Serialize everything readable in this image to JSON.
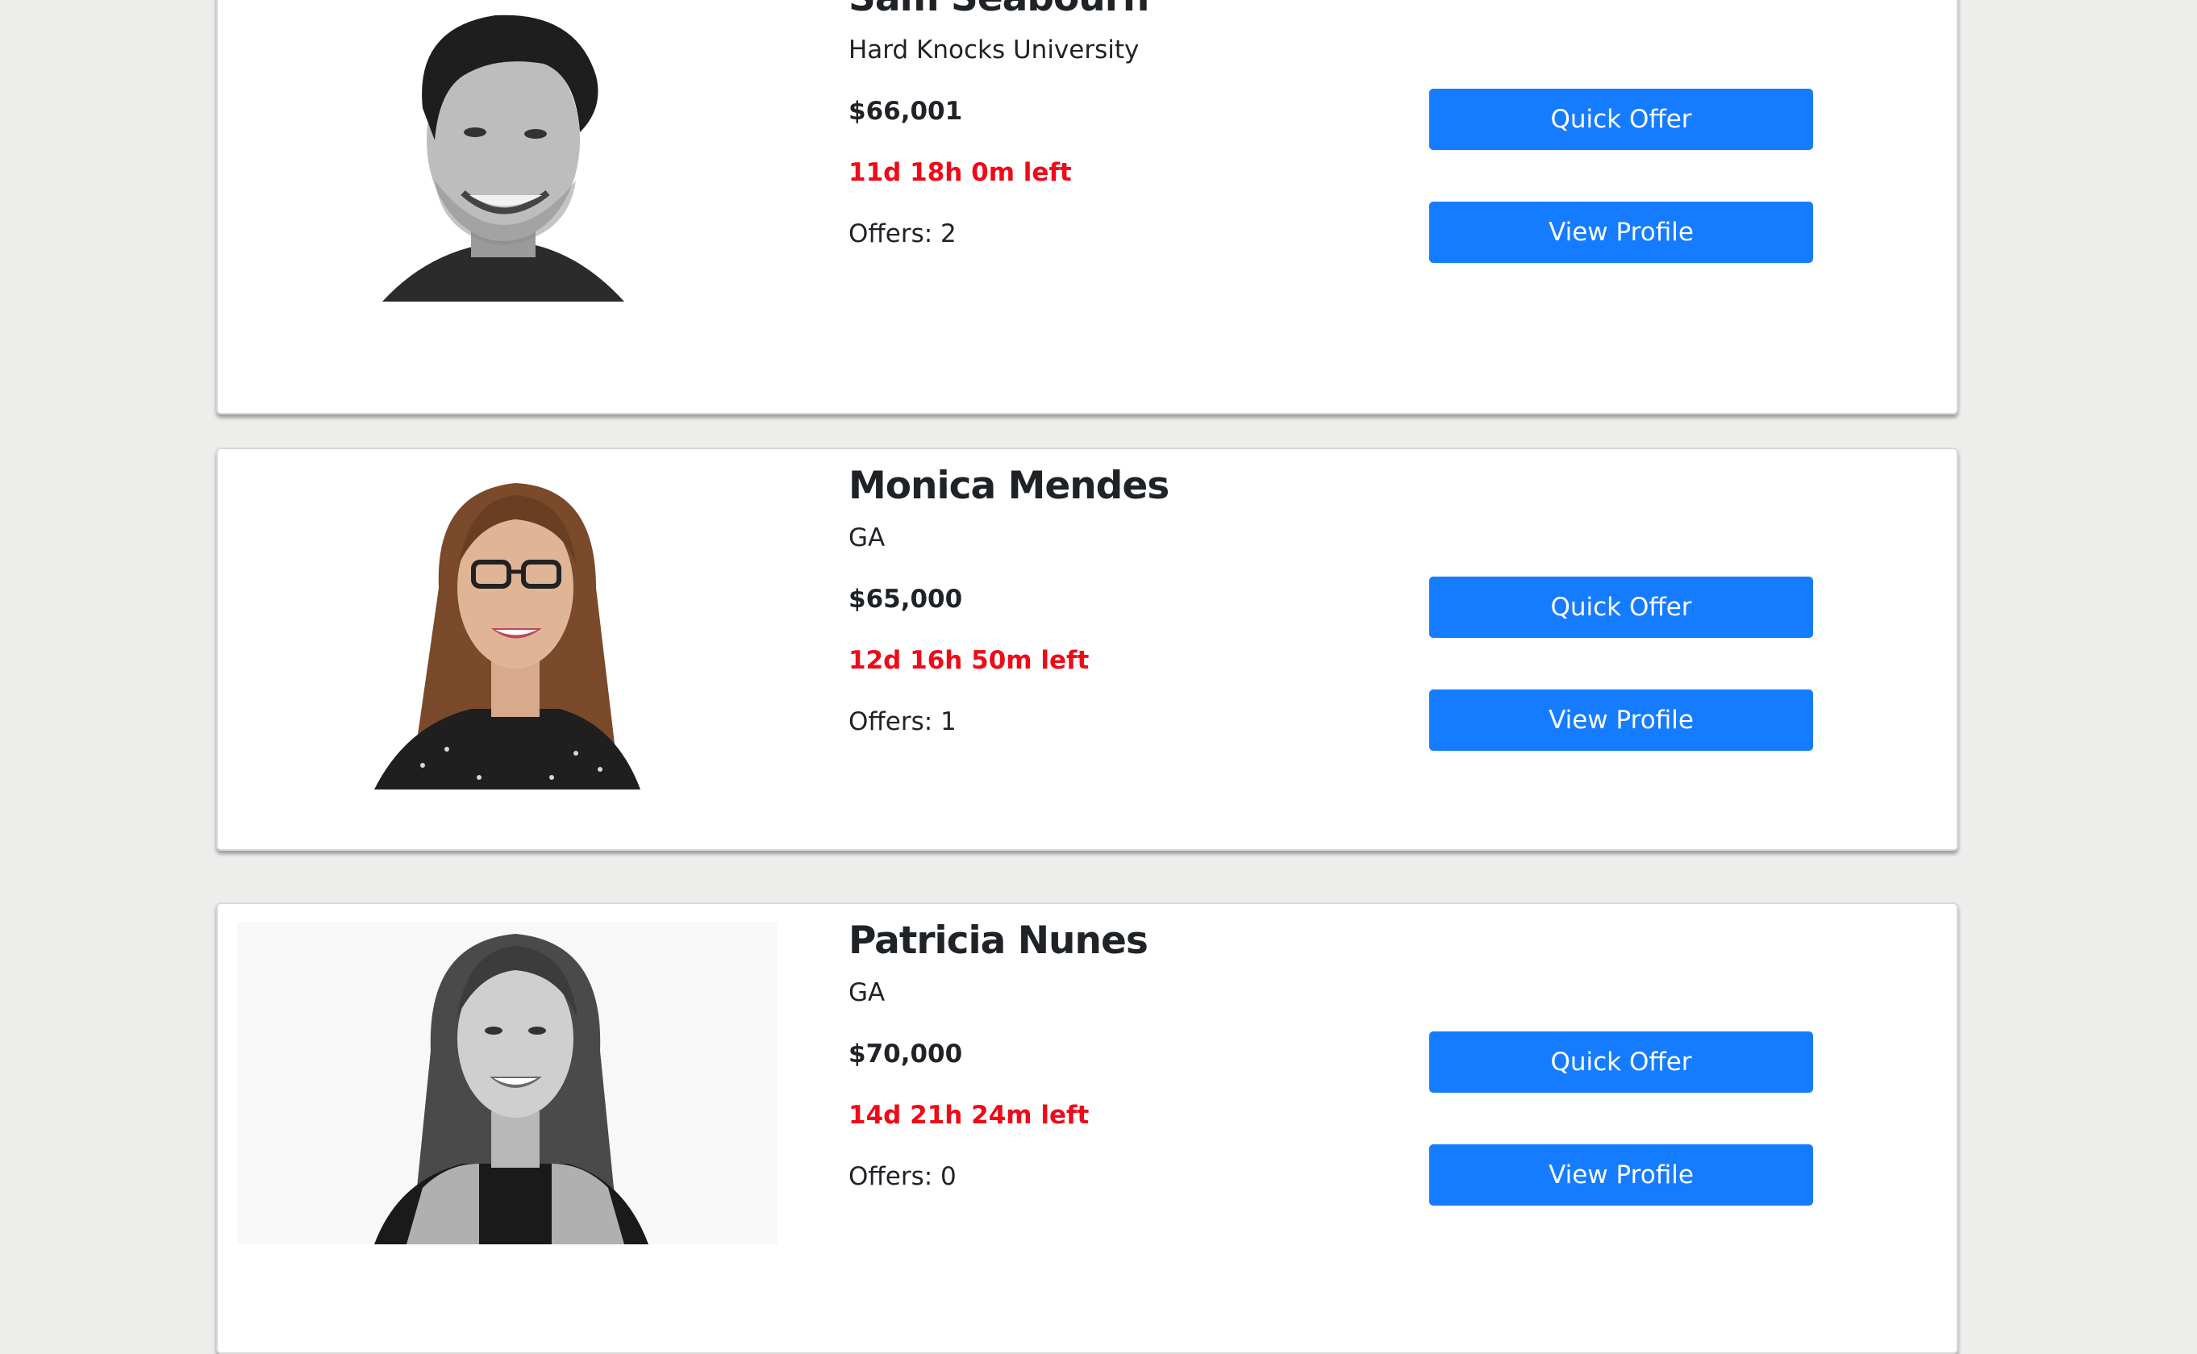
{
  "candidates": [
    {
      "name": "Sam Seabourn",
      "school": "Hard Knocks University",
      "salary": "$66,001",
      "time_left": "11d 18h 0m left",
      "offers": "Offers: 2",
      "quick_offer_label": "Quick Offer",
      "view_profile_label": "View Profile"
    },
    {
      "name": "Monica Mendes",
      "school": "GA",
      "salary": "$65,000",
      "time_left": "12d 16h 50m left",
      "offers": "Offers: 1",
      "quick_offer_label": "Quick Offer",
      "view_profile_label": "View Profile"
    },
    {
      "name": "Patricia Nunes",
      "school": "GA",
      "salary": "$70,000",
      "time_left": "14d 21h 24m left",
      "offers": "Offers: 0",
      "quick_offer_label": "Quick Offer",
      "view_profile_label": "View Profile"
    }
  ],
  "colors": {
    "background": "#ededeb",
    "button": "#167cff",
    "time_left": "#ef0a18"
  }
}
